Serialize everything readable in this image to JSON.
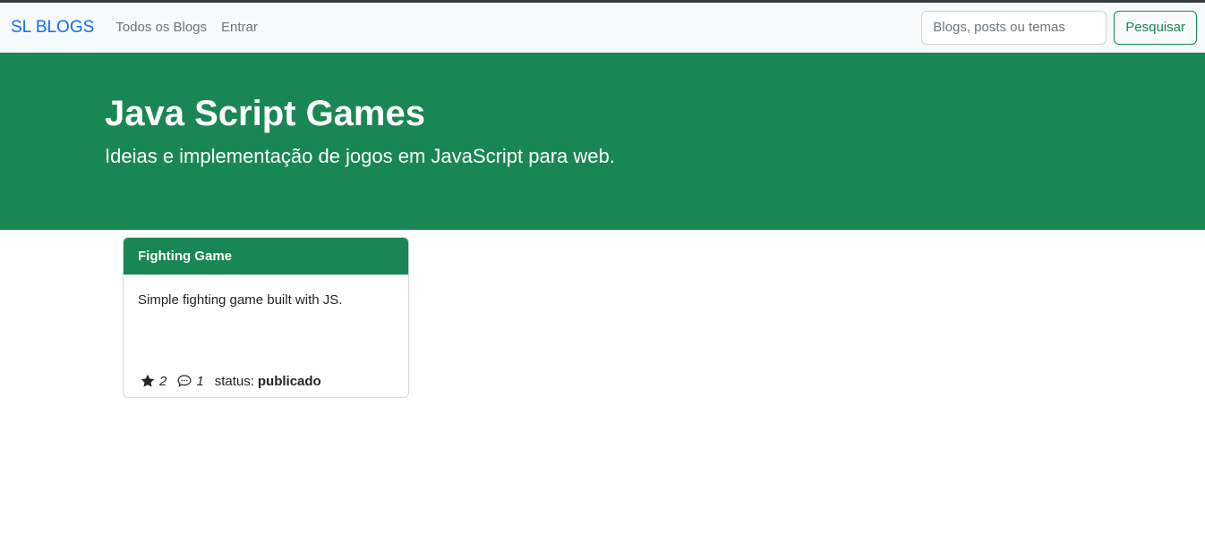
{
  "navbar": {
    "brand": "SL BLOGS",
    "links": [
      "Todos os Blogs",
      "Entrar"
    ],
    "search": {
      "placeholder": "Blogs, posts ou temas",
      "value": ""
    },
    "search_button": "Pesquisar"
  },
  "hero": {
    "title": "Java Script Games",
    "subtitle": "Ideias e implementação de jogos em JavaScript para web."
  },
  "posts": [
    {
      "title": "Fighting Game",
      "description": "Simple fighting game built with JS.",
      "stars": "2",
      "comments": "1",
      "status_label": "status:",
      "status_value": "publicado",
      "star_icon": "star-icon",
      "comment_icon": "chat-bubble-icon"
    }
  ],
  "colors": {
    "primary_green": "#198754",
    "brand_blue": "#0d6efd",
    "navbar_bg": "#f8f9fa"
  }
}
